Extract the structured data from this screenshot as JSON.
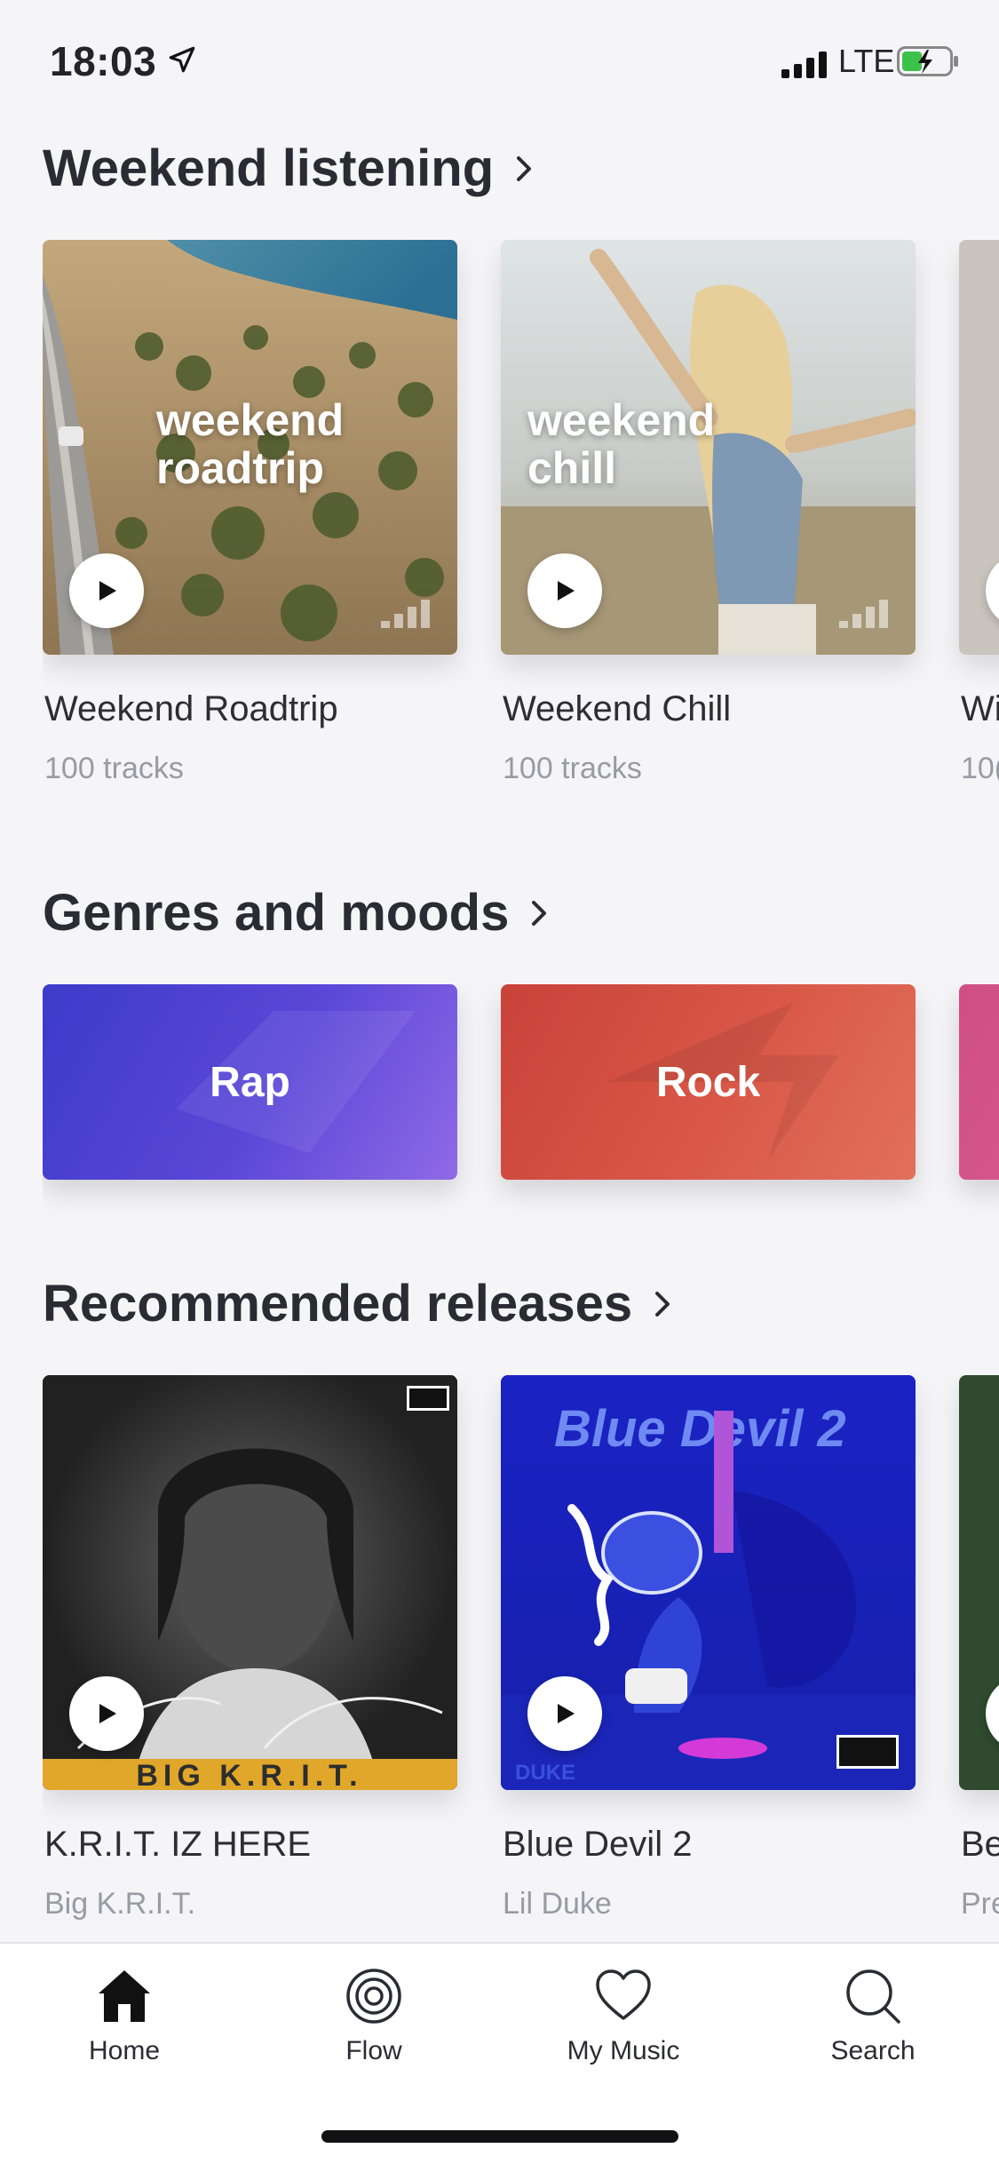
{
  "status_bar": {
    "time": "18:03",
    "network": "LTE"
  },
  "sections": {
    "weekend": {
      "title": "Weekend listening",
      "cards": [
        {
          "overlay": "weekend roadtrip",
          "title": "Weekend Roadtrip",
          "subtitle": "100 tracks"
        },
        {
          "overlay": "weekend chill",
          "title": "Weekend Chill",
          "subtitle": "100 tracks"
        },
        {
          "title": "Wi",
          "subtitle": "10("
        }
      ]
    },
    "genres": {
      "title": "Genres and moods",
      "cards": [
        {
          "label": "Rap",
          "color": "#5a3fd6"
        },
        {
          "label": "Rock",
          "color": "#d95848"
        },
        {
          "label": "",
          "color": "#d95b8f"
        }
      ]
    },
    "releases": {
      "title": "Recommended releases",
      "cards": [
        {
          "title": "K.R.I.T. IZ HERE",
          "subtitle": "Big K.R.I.T.",
          "art_text": "BIG K.R.I.T."
        },
        {
          "title": "Blue Devil 2",
          "subtitle": "Lil Duke",
          "art_text": "Blue Devil 2",
          "art_sub": "DUKE"
        },
        {
          "title": "Be",
          "subtitle": "Pre"
        }
      ]
    }
  },
  "tab_bar": {
    "items": [
      {
        "label": "Home",
        "icon": "home-icon",
        "active": true
      },
      {
        "label": "Flow",
        "icon": "flow-icon"
      },
      {
        "label": "My Music",
        "icon": "heart-icon"
      },
      {
        "label": "Search",
        "icon": "search-icon"
      }
    ]
  }
}
